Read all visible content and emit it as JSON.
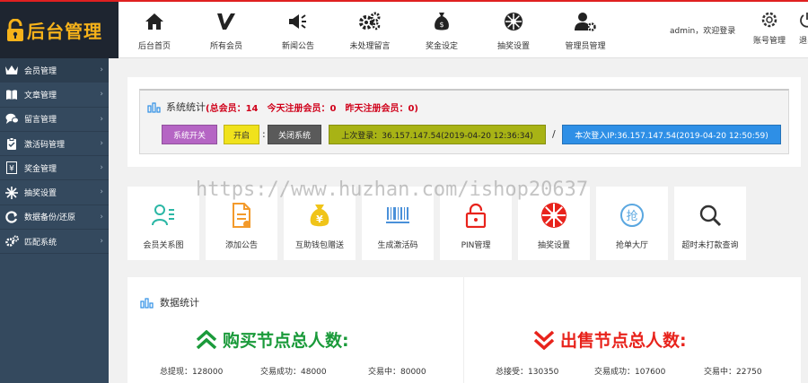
{
  "logo": {
    "text": "后台管理"
  },
  "nav": [
    {
      "label": "后台首页",
      "icon": "home-icon"
    },
    {
      "label": "所有会员",
      "icon": "v-logo-icon"
    },
    {
      "label": "新闻公告",
      "icon": "megaphone-icon"
    },
    {
      "label": "未处理留言",
      "icon": "gears-icon"
    },
    {
      "label": "奖金设定",
      "icon": "money-bag-icon"
    },
    {
      "label": "抽奖设置",
      "icon": "wheel-icon"
    },
    {
      "label": "管理员管理",
      "icon": "user-gear-icon"
    }
  ],
  "header": {
    "welcome": "admin，欢迎登录",
    "account_label": "账号管理",
    "logout_label": "退出"
  },
  "sidebar": {
    "items": [
      {
        "label": "会员管理",
        "icon": "crown-icon"
      },
      {
        "label": "文章管理",
        "icon": "book-icon"
      },
      {
        "label": "留言管理",
        "icon": "chat-icon"
      },
      {
        "label": "激活码管理",
        "icon": "clipboard-icon"
      },
      {
        "label": "奖金管理",
        "icon": "yen-note-icon"
      },
      {
        "label": "抽奖设置",
        "icon": "snowflake-icon"
      },
      {
        "label": "数据备份/还原",
        "icon": "refresh-icon"
      },
      {
        "label": "匹配系统",
        "icon": "gears-icon"
      }
    ],
    "arrow": "›"
  },
  "stats": {
    "title": "系统统计",
    "summary": "(总会员：14　今天注册会员：0　昨天注册会员：0)",
    "switch_label": "系统开关",
    "open_label": "开启",
    "colon": ":",
    "close_label": "关闭系统",
    "last_login": "上次登录：36.157.147.54(2019-04-20 12:36:34)",
    "slash": "/",
    "this_login": "本次登入IP:36.157.147.54(2019-04-20 12:50:59)"
  },
  "tiles": [
    {
      "label": "会员关系图",
      "icon": "member-tree-icon"
    },
    {
      "label": "添加公告",
      "icon": "add-notice-icon"
    },
    {
      "label": "互助钱包赠送",
      "icon": "yen-bag-icon"
    },
    {
      "label": "生成激活码",
      "icon": "barcode-icon"
    },
    {
      "label": "PIN管理",
      "icon": "lock-icon"
    },
    {
      "label": "抽奖设置",
      "icon": "wheel-icon"
    },
    {
      "label": "抢单大厅",
      "icon": "grab-icon"
    },
    {
      "label": "超时未打款查询",
      "icon": "search-icon"
    }
  ],
  "data_stats": {
    "title": "数据统计",
    "buy": {
      "heading": "购买节点总人数:",
      "total": "总提现：128000",
      "success": "交易成功：48000",
      "pending": "交易中：80000"
    },
    "sell": {
      "heading": "出售节点总人数:",
      "total": "总接受：130350",
      "success": "交易成功：107600",
      "pending": "交易中：22750"
    }
  },
  "watermark": "https://www.huzhan.com/ishop20637",
  "colors": {
    "sidebar_bg": "#34495e",
    "logo_bg": "#1e2530",
    "logo_text": "#f6b21a",
    "accent_red": "#d0021b",
    "green": "#1a9a3a",
    "btn_purple": "#b565c4",
    "btn_yellow": "#f0e21c",
    "btn_dark": "#5a5a5a",
    "btn_olive": "#a8b315",
    "btn_blue": "#2e8fe6"
  }
}
